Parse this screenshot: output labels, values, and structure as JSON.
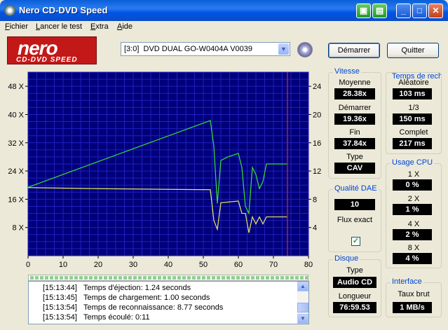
{
  "window": {
    "title": "Nero CD-DVD Speed"
  },
  "menu": [
    {
      "label": "Fichier",
      "key": "F",
      "rest": "ichier"
    },
    {
      "label": "Lancer le test",
      "key": "L",
      "rest": "ancer le test"
    },
    {
      "label": "Extra",
      "key": "E",
      "rest": "xtra"
    },
    {
      "label": "Aide",
      "key": "A",
      "rest": "ide"
    }
  ],
  "logo": {
    "text": "nero",
    "sub": "CD-DVD SPEED"
  },
  "drive": {
    "selected": "[3:0]  DVD DUAL GO-W0404A V0039"
  },
  "buttons": {
    "start": "Démarrer",
    "quit": "Quitter"
  },
  "speed": {
    "title": "Vitesse",
    "avg_label": "Moyenne",
    "avg": "28.38x",
    "start_label": "Démarrer",
    "start": "19.36x",
    "end_label": "Fin",
    "end": "37.84x",
    "type_label": "Type",
    "type": "CAV"
  },
  "seek": {
    "title": "Temps de recherche",
    "random_label": "Aléatoire",
    "random": "103 ms",
    "third_label": "1/3",
    "third": "150 ms",
    "full_label": "Complet",
    "full": "217 ms"
  },
  "dae": {
    "title": "Qualité DAE",
    "value": "10",
    "exact_label": "Flux exact",
    "exact_checked": true
  },
  "cpu": {
    "title": "Usage CPU",
    "rows": [
      {
        "label": "1 X",
        "value": "0 %"
      },
      {
        "label": "2 X",
        "value": "1 %"
      },
      {
        "label": "4 X",
        "value": "2 %"
      },
      {
        "label": "8 X",
        "value": "4 %"
      }
    ]
  },
  "disc": {
    "title": "Disque",
    "type_label": "Type",
    "type": "Audio CD",
    "length_label": "Longueur",
    "length": "76:59.53"
  },
  "interface": {
    "title": "Interface",
    "burst_label": "Taux brut",
    "burst": "1 MB/s"
  },
  "log": [
    {
      "time": "[15:13:44]",
      "text": "Temps d'éjection: 1.24 seconds"
    },
    {
      "time": "[15:13:45]",
      "text": "Temps de chargement: 1.00 seconds"
    },
    {
      "time": "[15:13:54]",
      "text": "Temps de reconnaissance: 8.77 seconds"
    },
    {
      "time": "[15:13:54]",
      "text": "Temps écoulé:  0:11"
    }
  ],
  "colors": {
    "plot_bg": "#00007a",
    "grid": "#2020c0",
    "speed_line": "#38e038",
    "cpu_line": "#e8e860",
    "marker": "#c02020",
    "title_accent": "#0046d5"
  },
  "chart_data": {
    "type": "line",
    "x": [
      0,
      52,
      54,
      55,
      58,
      61,
      62,
      63,
      64,
      65,
      66,
      67,
      68,
      69,
      70,
      71,
      72,
      73,
      74
    ],
    "xlim": [
      0,
      80
    ],
    "xticks": [
      "0",
      "10",
      "20",
      "30",
      "40",
      "50",
      "60",
      "70",
      "80"
    ],
    "yleft_ticks": [
      "8 X",
      "16 X",
      "24 X",
      "32 X",
      "40 X",
      "48 X"
    ],
    "yleft_lim": [
      0,
      52
    ],
    "yright_ticks": [
      "4",
      "8",
      "12",
      "16",
      "20",
      "24"
    ],
    "yright_lim": [
      0,
      26
    ],
    "position_marker_x": 74,
    "series": [
      {
        "key": "read_speed",
        "color": "#38e038",
        "points": [
          [
            0,
            19.4
          ],
          [
            52,
            38.3
          ],
          [
            53,
            31
          ],
          [
            54,
            14.8
          ],
          [
            55,
            27
          ],
          [
            57,
            28
          ],
          [
            60,
            29
          ],
          [
            61,
            25
          ],
          [
            62,
            14
          ],
          [
            63,
            12
          ],
          [
            64,
            25
          ],
          [
            65,
            23
          ],
          [
            66,
            19
          ],
          [
            67,
            21
          ],
          [
            68,
            26
          ],
          [
            74,
            26
          ]
        ]
      },
      {
        "key": "cpu_usage",
        "color": "#e8e860",
        "points": [
          [
            0,
            19.3
          ],
          [
            20,
            19.0
          ],
          [
            52,
            18.7
          ],
          [
            53,
            10
          ],
          [
            54,
            7.5
          ],
          [
            55,
            15
          ],
          [
            60,
            15.5
          ],
          [
            61,
            12
          ],
          [
            62,
            12
          ],
          [
            63,
            6.5
          ],
          [
            64,
            11
          ],
          [
            65,
            9
          ],
          [
            66,
            11
          ],
          [
            67,
            9
          ],
          [
            68,
            11
          ],
          [
            74,
            11
          ]
        ]
      }
    ]
  }
}
